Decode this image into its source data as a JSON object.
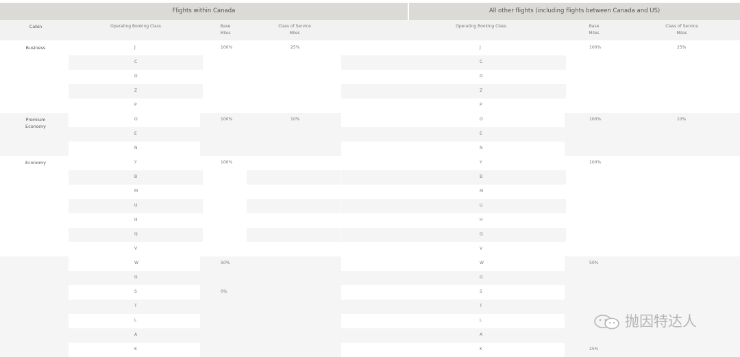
{
  "headers": {
    "canada": "Flights within Canada",
    "other": "All other flights (including flights between Canada and US)"
  },
  "subheaders": {
    "cabin": "Cabin",
    "obc_canada": "Operating Booking Class",
    "base_canada": [
      "Base",
      "Miles"
    ],
    "cos_canada": [
      "Class of Service",
      "Miles"
    ],
    "obc_other": "Operating Booking Class",
    "base_other": [
      "Base",
      "Miles"
    ],
    "cos_other": [
      "Class of Service",
      "Miles"
    ]
  },
  "cabins": [
    {
      "name": [
        "Business"
      ],
      "start": 0,
      "count": 5
    },
    {
      "name": [
        "Premium",
        "Economy"
      ],
      "start": 5,
      "count": 3
    },
    {
      "name": [
        "Economy"
      ],
      "start": 8,
      "count": 13
    }
  ],
  "rows": [
    {
      "cls": "J",
      "base_ca": "100%",
      "cos_ca": "25%",
      "base_ot": "100%",
      "cos_ot": "25%"
    },
    {
      "cls": "C",
      "base_ca": "",
      "cos_ca": "",
      "base_ot": "",
      "cos_ot": ""
    },
    {
      "cls": "D",
      "base_ca": "",
      "cos_ca": "",
      "base_ot": "",
      "cos_ot": ""
    },
    {
      "cls": "Z",
      "base_ca": "",
      "cos_ca": "",
      "base_ot": "",
      "cos_ot": ""
    },
    {
      "cls": "P",
      "base_ca": "",
      "cos_ca": "",
      "base_ot": "",
      "cos_ot": ""
    },
    {
      "cls": "O",
      "base_ca": "100%",
      "cos_ca": "10%",
      "base_ot": "100%",
      "cos_ot": "10%"
    },
    {
      "cls": "E",
      "base_ca": "",
      "cos_ca": "",
      "base_ot": "",
      "cos_ot": ""
    },
    {
      "cls": "N",
      "base_ca": "",
      "cos_ca": "",
      "base_ot": "",
      "cos_ot": ""
    },
    {
      "cls": "Y",
      "base_ca": "100%",
      "cos_ca": "",
      "base_ot": "100%",
      "cos_ot": ""
    },
    {
      "cls": "B",
      "base_ca": "",
      "cos_ca": "",
      "base_ot": "",
      "cos_ot": ""
    },
    {
      "cls": "M",
      "base_ca": "",
      "cos_ca": "",
      "base_ot": "",
      "cos_ot": ""
    },
    {
      "cls": "U",
      "base_ca": "",
      "cos_ca": "",
      "base_ot": "",
      "cos_ot": ""
    },
    {
      "cls": "H",
      "base_ca": "",
      "cos_ca": "",
      "base_ot": "",
      "cos_ot": ""
    },
    {
      "cls": "Q",
      "base_ca": "",
      "cos_ca": "",
      "base_ot": "",
      "cos_ot": ""
    },
    {
      "cls": "V",
      "base_ca": "",
      "cos_ca": "",
      "base_ot": "",
      "cos_ot": ""
    },
    {
      "cls": "W",
      "base_ca": "50%",
      "cos_ca": "",
      "base_ot": "50%",
      "cos_ot": ""
    },
    {
      "cls": "G",
      "base_ca": "",
      "cos_ca": "",
      "base_ot": "",
      "cos_ot": ""
    },
    {
      "cls": "S",
      "base_ca": "0%",
      "cos_ca": "",
      "base_ot": "",
      "cos_ot": ""
    },
    {
      "cls": "T",
      "base_ca": "",
      "cos_ca": "",
      "base_ot": "",
      "cos_ot": ""
    },
    {
      "cls": "L",
      "base_ca": "",
      "cos_ca": "",
      "base_ot": "",
      "cos_ot": ""
    },
    {
      "cls": "A",
      "base_ca": "",
      "cos_ca": "",
      "base_ot": "",
      "cos_ot": ""
    },
    {
      "cls": "K",
      "base_ca": "",
      "cos_ca": "",
      "base_ot": "25%",
      "cos_ot": ""
    }
  ],
  "watermark": {
    "text": "抛因特达人",
    "icon": "wechat-icon"
  },
  "colors": {
    "header_bg": "#dcdad7",
    "stripe": "#f5f5f5",
    "text": "#777777"
  }
}
